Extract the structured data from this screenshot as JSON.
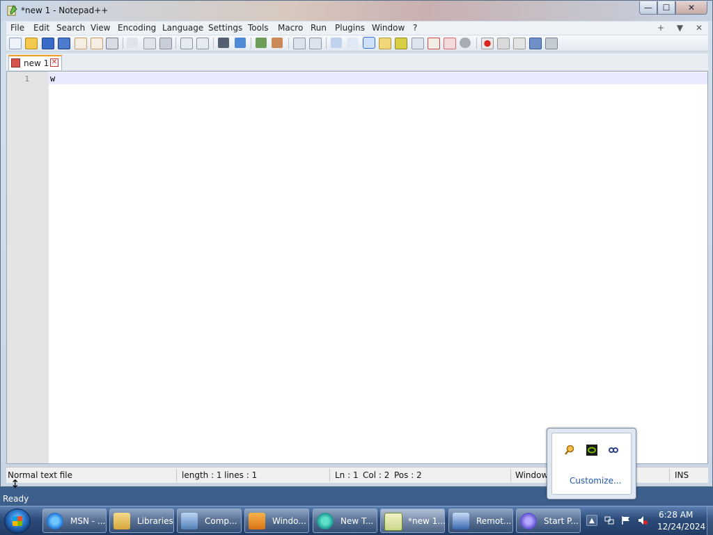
{
  "window": {
    "title": "*new 1 - Notepad++",
    "controls": {
      "minimize": "—",
      "maximize": "☐",
      "close": "✕"
    }
  },
  "menu": {
    "items": [
      "File",
      "Edit",
      "Search",
      "View",
      "Encoding",
      "Language",
      "Settings",
      "Tools",
      "Macro",
      "Run",
      "Plugins",
      "Window",
      "?"
    ],
    "right_controls": [
      "+",
      "▼",
      "✕"
    ]
  },
  "toolbar": {
    "icons": [
      "new-file-icon",
      "open-file-icon",
      "save-icon",
      "save-all-icon",
      "close-icon",
      "close-all-icon",
      "print-icon",
      "cut-icon",
      "copy-icon",
      "paste-icon",
      "undo-icon",
      "redo-icon",
      "find-icon",
      "replace-icon",
      "zoom-in-icon",
      "zoom-out-icon",
      "sync-vertical-icon",
      "sync-horizontal-icon",
      "word-wrap-icon",
      "show-all-characters-icon",
      "indent-guide-icon",
      "user-language-icon",
      "doc-map-icon",
      "function-list-icon",
      "folder-as-workspace-icon",
      "monitoring-icon",
      "record-macro-icon",
      "stop-macro-icon",
      "play-macro-icon",
      "run-macro-multiple-icon",
      "save-macro-icon"
    ],
    "selected": "indent-guide-icon"
  },
  "tabs": [
    {
      "label": "new 1",
      "close": "✕"
    }
  ],
  "editor": {
    "lines": [
      {
        "number": "1",
        "text": "w"
      }
    ]
  },
  "statusbar": {
    "file_type": "Normal text file",
    "length": "length : 1",
    "lines": "lines : 1",
    "ln": "Ln : 1",
    "col": "Col : 2",
    "pos": "Pos : 2",
    "eol": "Window",
    "mode": "INS"
  },
  "below_window": {
    "ready": "Ready"
  },
  "tray_popup": {
    "icons": [
      "search-tool-icon",
      "nvidia-icon",
      "link-icon"
    ],
    "customize": "Customize..."
  },
  "taskbar": {
    "items": [
      {
        "label": "MSN - ...",
        "icon": "internet-explorer-icon"
      },
      {
        "label": "Libraries",
        "icon": "folder-icon"
      },
      {
        "label": "Comp...",
        "icon": "computer-icon"
      },
      {
        "label": "Windo...",
        "icon": "media-player-icon"
      },
      {
        "label": "New T...",
        "icon": "new-tab-icon"
      },
      {
        "label": "*new 1...",
        "icon": "notepad-plus-plus-icon",
        "active": true
      },
      {
        "label": "Remot...",
        "icon": "remote-desktop-icon"
      },
      {
        "label": "Start P...",
        "icon": "start-page-icon"
      }
    ],
    "tray_chevron": "▲",
    "clock": {
      "time": "6:28 AM",
      "date": "12/24/2024"
    }
  }
}
